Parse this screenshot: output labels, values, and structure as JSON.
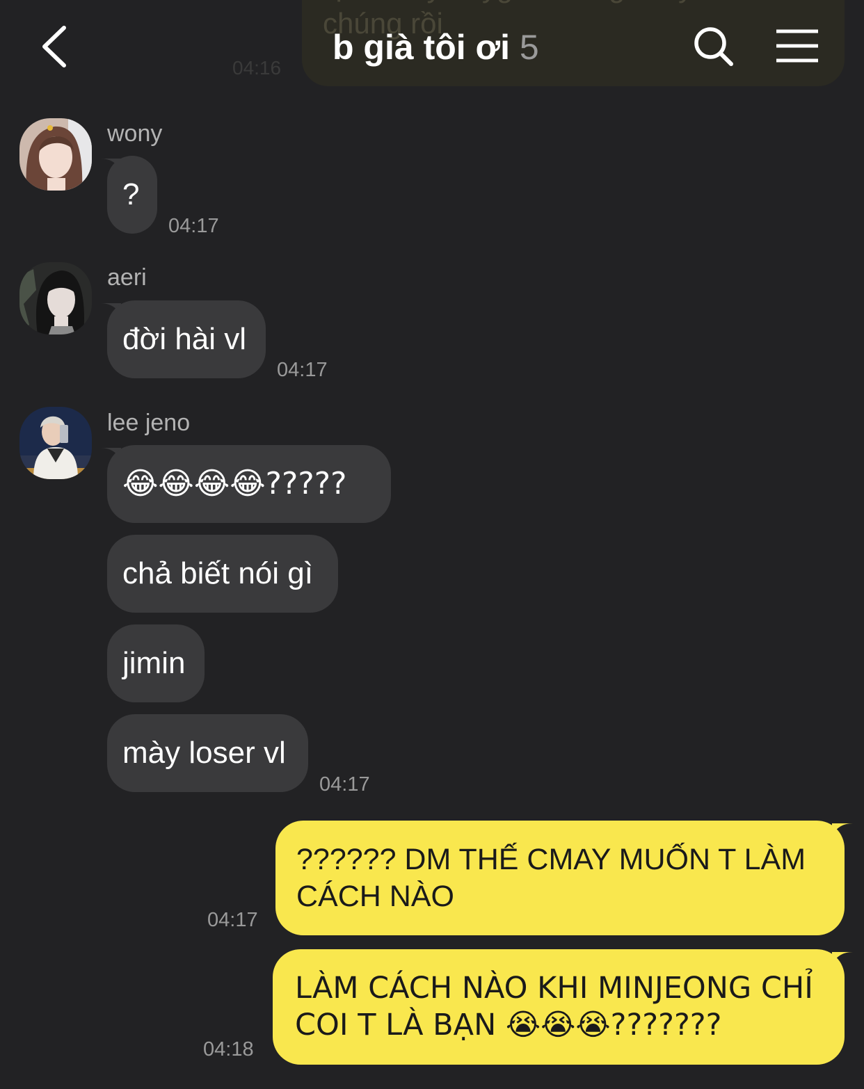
{
  "header": {
    "title": "b già tôi ơi",
    "member_count": "5"
  },
  "previous_message": {
    "text": "tại danny bâyg đã là người yêu mới\nchúng rồi",
    "time": "04:16"
  },
  "messages": [
    {
      "sender": "wony",
      "bubbles": [
        "?"
      ],
      "time": "04:17"
    },
    {
      "sender": "aeri",
      "bubbles": [
        "đời hài vl"
      ],
      "time": "04:17"
    },
    {
      "sender": "lee jeno",
      "bubbles": [
        "😂😂😂😂?????",
        "chả biết nói gì",
        "jimin",
        "mày loser vl"
      ],
      "time": "04:17"
    }
  ],
  "my_messages": [
    {
      "text": "?????? DM THẾ CMAY MUỐN T LÀM\nCÁCH NÀO",
      "time": "04:17"
    },
    {
      "text": "LÀM CÁCH NÀO KHI MINJEONG CHỈ\nCOI T LÀ BẠN 😭😭😭???????",
      "time": "04:18"
    }
  ],
  "colors": {
    "background": "#222224",
    "incoming_bubble": "#3a3a3c",
    "outgoing_bubble": "#f9e74e"
  },
  "icons": [
    "back-arrow-icon",
    "search-icon",
    "menu-icon"
  ]
}
